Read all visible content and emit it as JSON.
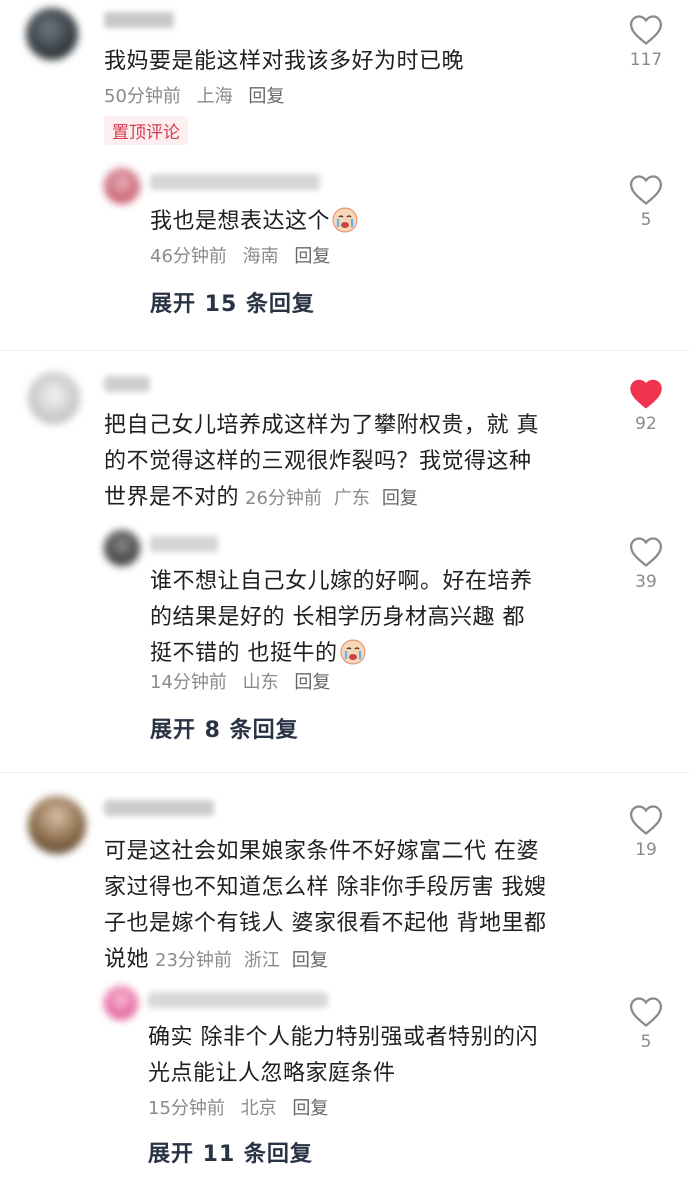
{
  "comments": [
    {
      "text": "我妈要是能这样对我该多好为时已晚",
      "time": "50分钟前",
      "location": "上海",
      "reply": "回复",
      "likes": "117",
      "liked": false,
      "pin_badge": "置顶评论",
      "sub": {
        "text": "我也是想表达这个",
        "time": "46分钟前",
        "location": "海南",
        "reply": "回复",
        "likes": "5"
      },
      "expand": "展开 15 条回复"
    },
    {
      "text_lines": [
        "把自己女儿培养成这样为了攀附权贵，就 真",
        "的不觉得这样的三观很炸裂吗？我觉得这种",
        "世界是不对的"
      ],
      "time": "26分钟前",
      "location": "广东",
      "reply": "回复",
      "likes": "92",
      "liked": true,
      "sub": {
        "text_lines": [
          "谁不想让自己女儿嫁的好啊。好在培养",
          "的结果是好的 长相学历身材高兴趣 都",
          "挺不错的  也挺牛的"
        ],
        "time": "14分钟前",
        "location": "山东",
        "reply": "回复",
        "likes": "39"
      },
      "expand": "展开 8 条回复"
    },
    {
      "text_lines": [
        "可是这社会如果娘家条件不好嫁富二代 在婆",
        "家过得也不知道怎么样 除非你手段厉害 我嫂",
        "子也是嫁个有钱人 婆家很看不起他 背地里都",
        "说她"
      ],
      "time": "23分钟前",
      "location": "浙江",
      "reply": "回复",
      "likes": "19",
      "liked": false,
      "sub": {
        "text_lines": [
          "确实  除非个人能力特别强或者特别的闪",
          "光点能让人忽略家庭条件"
        ],
        "time": "15分钟前",
        "location": "北京",
        "reply": "回复",
        "likes": "5"
      },
      "expand": "展开 11 条回复"
    }
  ],
  "colors": {
    "liked": "#f0334f",
    "like_outline": "#8a8a8a",
    "pin": "#d83a4e",
    "expand": "#2a3246"
  }
}
